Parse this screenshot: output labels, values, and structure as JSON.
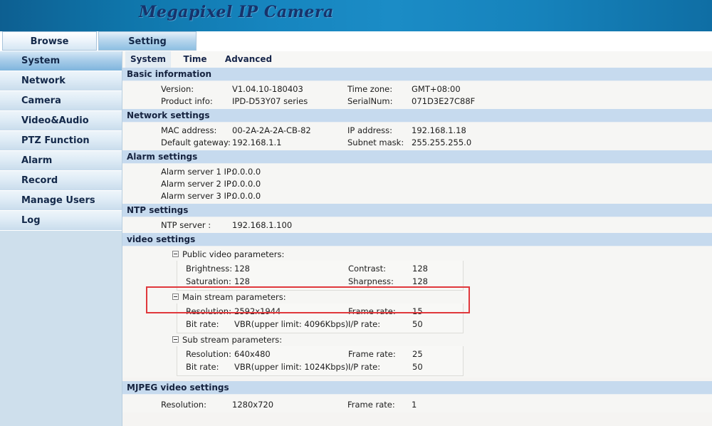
{
  "header": {
    "title": "Megapixel IP Camera"
  },
  "main_tabs": [
    {
      "label": "Browse",
      "active": false
    },
    {
      "label": "Setting",
      "active": true
    }
  ],
  "sidebar": {
    "items": [
      {
        "label": "System",
        "active": true
      },
      {
        "label": "Network",
        "active": false
      },
      {
        "label": "Camera",
        "active": false
      },
      {
        "label": "Video&Audio",
        "active": false
      },
      {
        "label": "PTZ Function",
        "active": false
      },
      {
        "label": "Alarm",
        "active": false
      },
      {
        "label": "Record",
        "active": false
      },
      {
        "label": "Manage Users",
        "active": false
      },
      {
        "label": "Log",
        "active": false
      }
    ]
  },
  "sub_tabs": [
    {
      "label": "System",
      "active": true
    },
    {
      "label": "Time",
      "active": false
    },
    {
      "label": "Advanced",
      "active": false
    }
  ],
  "sections": {
    "basic_information": {
      "title": "Basic information",
      "rows": [
        {
          "label1": "Version:",
          "value1": "V1.04.10-180403",
          "label2": "Time zone:",
          "value2": "GMT+08:00"
        },
        {
          "label1": "Product info:",
          "value1": "IPD-D53Y07 series",
          "label2": "SerialNum:",
          "value2": "071D3E27C88F"
        }
      ]
    },
    "network_settings": {
      "title": "Network settings",
      "rows": [
        {
          "label1": "MAC address:",
          "value1": "00-2A-2A-2A-CB-82",
          "label2": "IP address:",
          "value2": "192.168.1.18"
        },
        {
          "label1": "Default gateway:",
          "value1": "192.168.1.1",
          "label2": "Subnet mask:",
          "value2": "255.255.255.0"
        }
      ]
    },
    "alarm_settings": {
      "title": "Alarm settings",
      "rows": [
        {
          "label1": "Alarm server 1 IP:",
          "value1": "0.0.0.0",
          "label2": "",
          "value2": ""
        },
        {
          "label1": "Alarm server 2 IP:",
          "value1": "0.0.0.0",
          "label2": "",
          "value2": ""
        },
        {
          "label1": "Alarm server 3 IP:",
          "value1": "0.0.0.0",
          "label2": "",
          "value2": ""
        }
      ]
    },
    "ntp_settings": {
      "title": "NTP settings",
      "rows": [
        {
          "label1": "NTP server :",
          "value1": "192.168.1.100",
          "label2": "",
          "value2": ""
        }
      ]
    },
    "video_settings": {
      "title": "video settings",
      "groups": [
        {
          "title": "Public video parameters:",
          "toggle": "collapse-icon",
          "rows": [
            {
              "label1": "Brightness:",
              "value1": "128",
              "label2": "Contrast:",
              "value2": "128"
            },
            {
              "label1": "Saturation:",
              "value1": "128",
              "label2": "Sharpness:",
              "value2": "128"
            }
          ]
        },
        {
          "title": "Main stream parameters:",
          "toggle": "collapse-icon",
          "highlighted": true,
          "rows": [
            {
              "label1": "Resolution:",
              "value1": "2592x1944",
              "label2": "Frame rate:",
              "value2": "15"
            },
            {
              "label1": "Bit rate:",
              "value1": "VBR(upper limit: 4096Kbps)",
              "label2": "I/P rate:",
              "value2": "50"
            }
          ]
        },
        {
          "title": "Sub stream parameters:",
          "toggle": "collapse-icon",
          "rows": [
            {
              "label1": "Resolution:",
              "value1": "640x480",
              "label2": "Frame rate:",
              "value2": "25"
            },
            {
              "label1": "Bit rate:",
              "value1": "VBR(upper limit: 1024Kbps)",
              "label2": "I/P rate:",
              "value2": "50"
            }
          ]
        }
      ]
    },
    "mjpeg_video_settings": {
      "title": "MJPEG video settings",
      "rows": [
        {
          "label1": "Resolution:",
          "value1": "1280x720",
          "label2": "Frame rate:",
          "value2": "1"
        }
      ]
    }
  },
  "annotation": {
    "highlight_color": "#e0383c",
    "target": "Main stream parameters resolution row"
  },
  "colors": {
    "banner_blue": "#1685bf",
    "title_navy": "#17336b",
    "section_header": "#c6daee",
    "sidebar_bg": "#cedfec",
    "content_bg": "#f5f4f2"
  }
}
